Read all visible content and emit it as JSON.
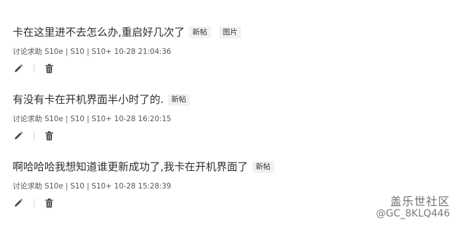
{
  "posts": [
    {
      "title": "卡在这里进不去怎么办,重启好几次了",
      "tags": [
        "新帖",
        "图片"
      ],
      "meta": "讨论求助 S10e | S10 | S10+ 10-28 21:04:36"
    },
    {
      "title": "有没有卡在开机界面半小时了的.",
      "tags": [
        "新帖"
      ],
      "meta": "讨论求助 S10e | S10 | S10+ 10-28 16:20:15"
    },
    {
      "title": "啊哈哈哈我想知道谁更新成功了,我卡在开机界面了",
      "tags": [
        "新帖"
      ],
      "meta": "讨论求助 S10e | S10 | S10+ 10-28 15:28:39"
    }
  ],
  "icons": {
    "edit": "pencil-icon",
    "delete": "trash-icon"
  },
  "watermark": {
    "brand": "盖乐世社区",
    "user": "@GC_8KLQ446"
  }
}
